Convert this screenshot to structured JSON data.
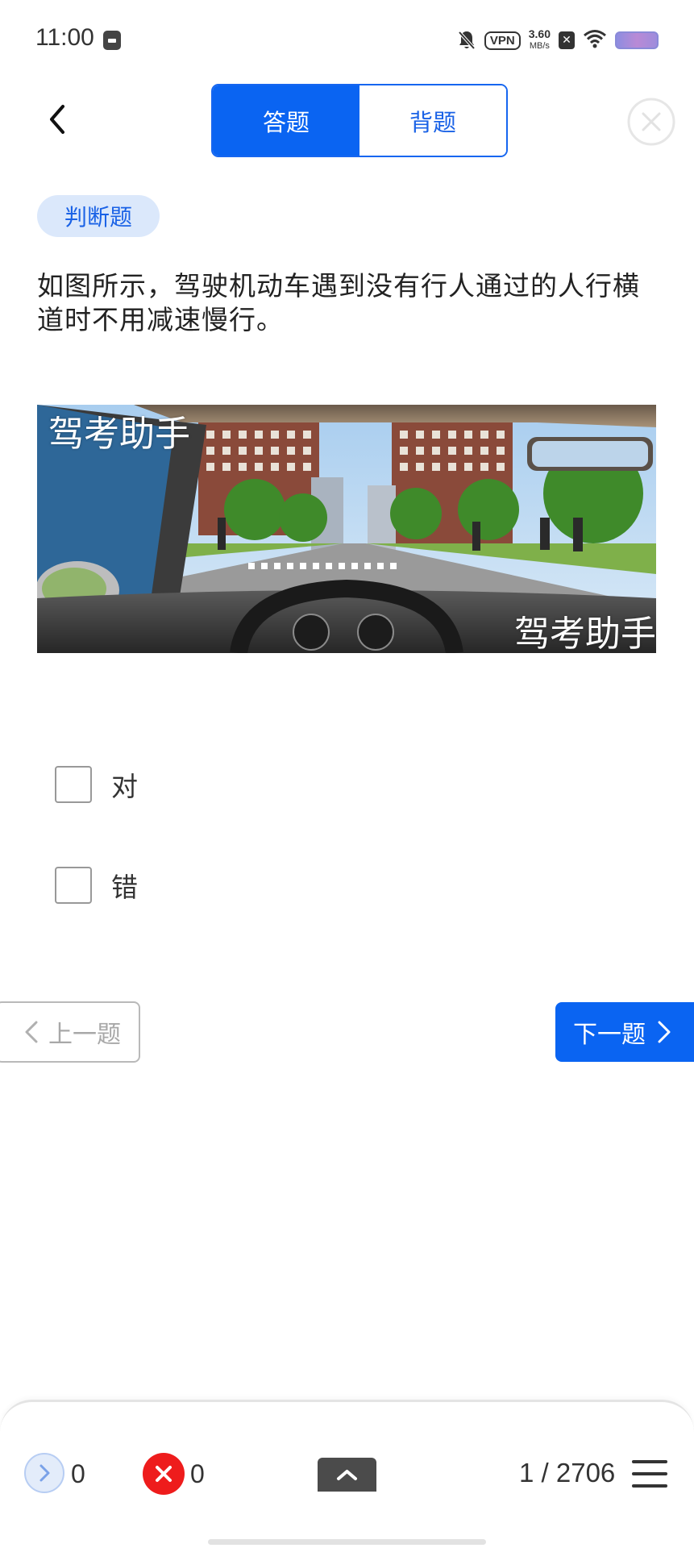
{
  "status_bar": {
    "time": "11:00",
    "vpn": "VPN",
    "net_speed_value": "3.60",
    "net_speed_unit": "MB/s",
    "sim_icon": "sim-x-icon",
    "battery_color": "#9e8cdc"
  },
  "header": {
    "back_icon": "chevron-left-icon",
    "tabs": [
      {
        "label": "答题",
        "active": true
      },
      {
        "label": "背题",
        "active": false
      }
    ],
    "close_icon": "close-circle-icon"
  },
  "question": {
    "type_badge": "判断题",
    "text": "如图所示，驾驶机动车遇到没有行人通过的人行横道时不用减速慢行。",
    "image_watermark_top": "驾考助手",
    "image_watermark_bottom": "驾考助手"
  },
  "options": [
    {
      "label": "对",
      "checked": false
    },
    {
      "label": "错",
      "checked": false
    }
  ],
  "navigation": {
    "prev_label": "上一题",
    "next_label": "下一题"
  },
  "bottom_bar": {
    "correct_count": "0",
    "wrong_count": "0",
    "progress": "1 / 2706",
    "current_index": 1,
    "total": 2706
  },
  "colors": {
    "accent": "#0a64f2",
    "badge_bg": "#dbe8fb",
    "wrong": "#ee1c1c"
  }
}
